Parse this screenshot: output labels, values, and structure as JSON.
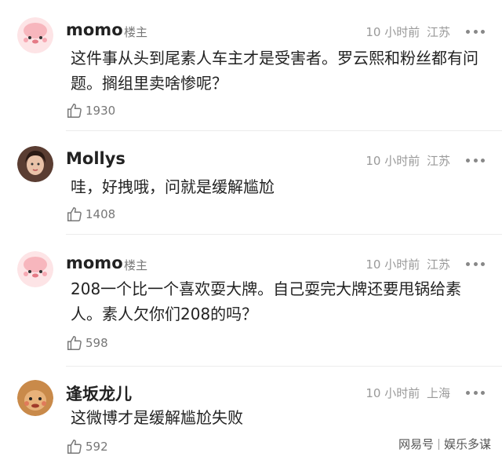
{
  "comments": [
    {
      "username": "momo",
      "owner_tag": "楼主",
      "time": "10 小时前",
      "location": "江苏",
      "text": "这件事从头到尾素人车主才是受害者。罗云熙和粉丝都有问题。搁组里卖啥惨呢？",
      "likes": "1930",
      "avatar_icon": "pink-cartoon-avatar-icon"
    },
    {
      "username": "Mollys",
      "owner_tag": "",
      "time": "10 小时前",
      "location": "江苏",
      "text": "哇，好拽哦，问就是缓解尴尬",
      "likes": "1408",
      "avatar_icon": "photo-avatar-icon"
    },
    {
      "username": "momo",
      "owner_tag": "楼主",
      "time": "10 小时前",
      "location": "江苏",
      "text": "208一个比一个喜欢耍大牌。自己耍完大牌还要甩锅给素人。素人欠你们208的吗？",
      "likes": "598",
      "avatar_icon": "pink-cartoon-avatar-icon"
    },
    {
      "username": "逢坂龙儿",
      "owner_tag": "",
      "time": "10 小时前",
      "location": "上海",
      "text": "这微博才是缓解尴尬失败",
      "likes": "592",
      "avatar_icon": "cartoon-face-avatar-icon"
    }
  ],
  "watermark": {
    "brand": "网易号",
    "channel": "娱乐多谋"
  }
}
